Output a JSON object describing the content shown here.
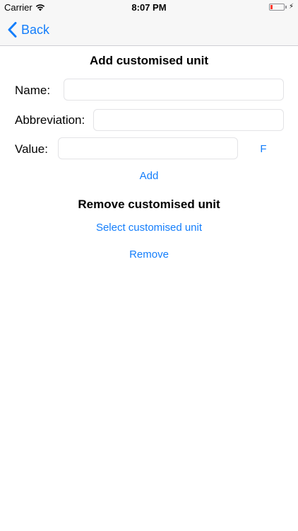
{
  "status_bar": {
    "carrier": "Carrier",
    "time": "8:07 PM",
    "wifi_icon": "wifi-icon",
    "battery_icon": "battery-icon",
    "charging_icon": "lightning-bolt-icon",
    "battery_color": "#ff3b30"
  },
  "nav": {
    "back_label": "Back",
    "back_icon": "chevron-left-icon",
    "accent_color": "#147efb"
  },
  "add_section": {
    "title": "Add customised unit",
    "name_label": "Name:",
    "name_value": "",
    "abbreviation_label": "Abbreviation:",
    "abbreviation_value": "",
    "value_label": "Value:",
    "value_value": "",
    "unit_button": "F",
    "add_button": "Add"
  },
  "remove_section": {
    "title": "Remove customised unit",
    "select_button": "Select customised unit",
    "remove_button": "Remove"
  }
}
